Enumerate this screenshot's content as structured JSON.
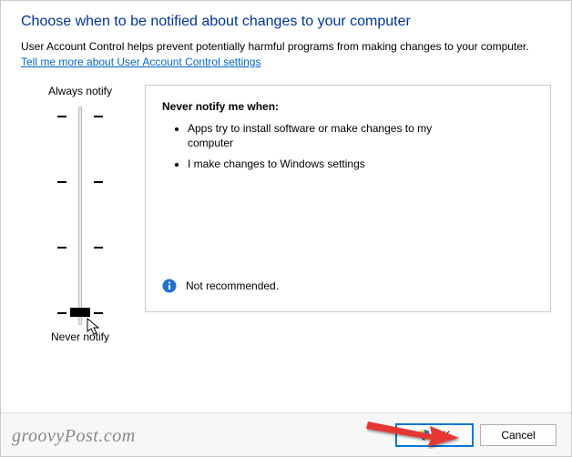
{
  "heading": "Choose when to be notified about changes to your computer",
  "description": "User Account Control helps prevent potentially harmful programs from making changes to your computer.",
  "link_text": "Tell me more about User Account Control settings",
  "slider": {
    "top_label": "Always notify",
    "bottom_label": "Never notify"
  },
  "panel": {
    "title": "Never notify me when:",
    "items": [
      "Apps try to install software or make changes to my computer",
      "I make changes to Windows settings"
    ],
    "status": "Not recommended."
  },
  "buttons": {
    "ok": "OK",
    "cancel": "Cancel"
  },
  "watermark": "groovyPost.com"
}
